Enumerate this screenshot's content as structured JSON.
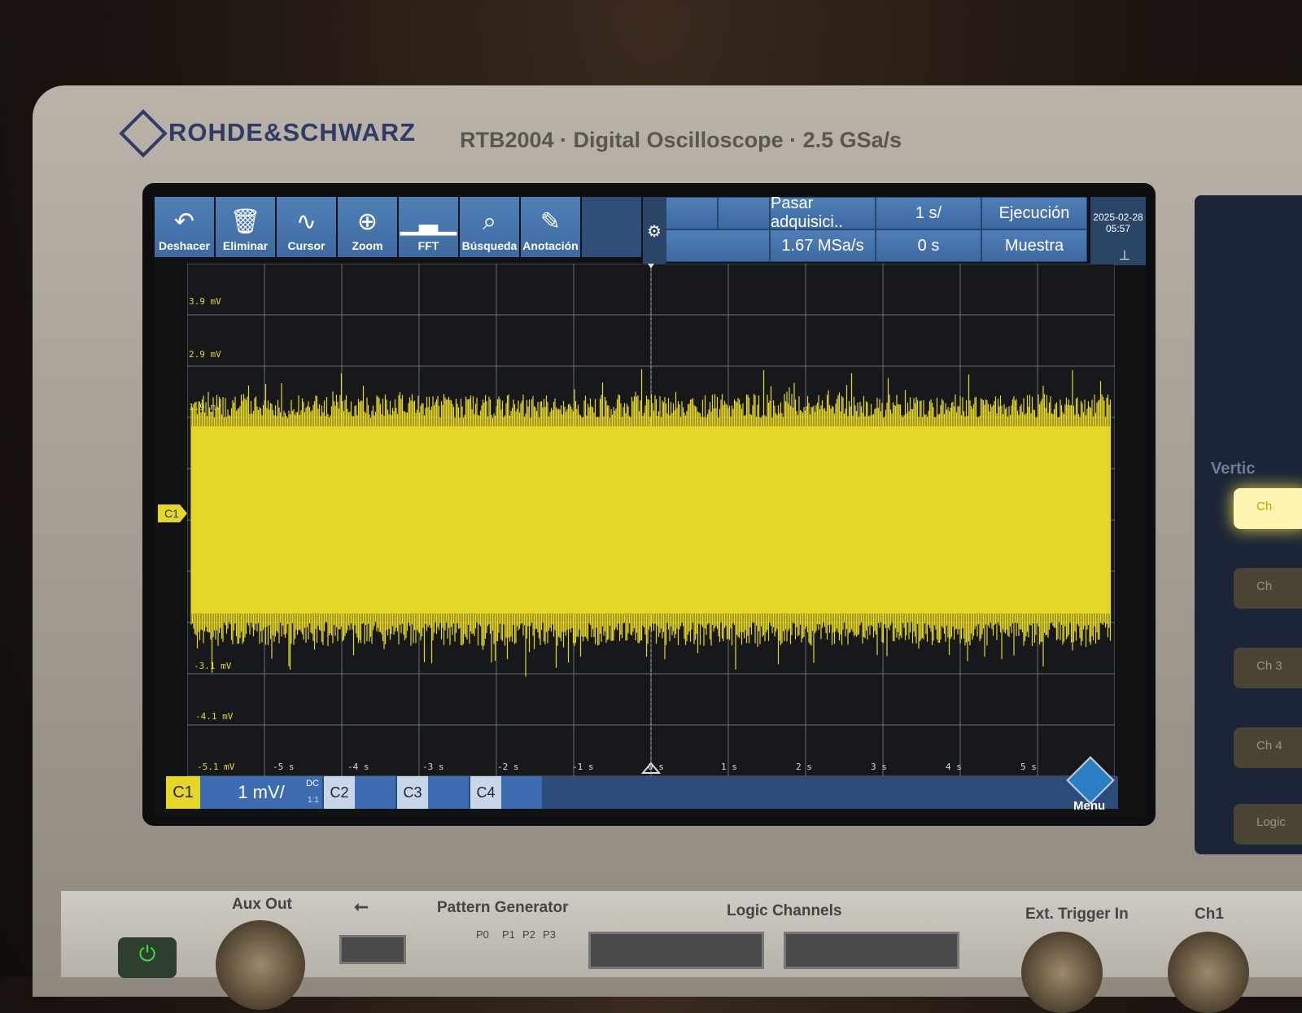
{
  "brand": {
    "name": "ROHDE&SCHWARZ",
    "model_line": "RTB2004 · Digital Oscilloscope · 2.5 GSa/s"
  },
  "toolbar": [
    {
      "label": "Deshacer",
      "icon": "undo-icon"
    },
    {
      "label": "Eliminar",
      "icon": "trash-icon"
    },
    {
      "label": "Cursor",
      "icon": "cursor-icon"
    },
    {
      "label": "Zoom",
      "icon": "zoom-icon"
    },
    {
      "label": "FFT",
      "icon": "fft-icon"
    },
    {
      "label": "Búsqueda",
      "icon": "search-icon"
    },
    {
      "label": "Anotación",
      "icon": "pencil-icon"
    }
  ],
  "status": {
    "acquisition": "Pasar adquisici..",
    "sample_rate": "1.67 MSa/s",
    "time_scale": "1 s/",
    "time_offset": "0 s",
    "run_state": "Ejecución",
    "mode": "Muestra",
    "date": "2025-02-28",
    "time": "05:57"
  },
  "plot": {
    "channel_marker": "C1",
    "y_labels": [
      "3.9 mV",
      "2.9 mV",
      "1.9 mV",
      "-3.1 mV",
      "-4.1 mV",
      "-5.1 mV"
    ],
    "x_labels": [
      "-5 s",
      "-4 s",
      "-3 s",
      "-2 s",
      "-1 s",
      "0 s",
      "1 s",
      "2 s",
      "3 s",
      "4 s",
      "5 s"
    ],
    "trace_color": "#e6d629"
  },
  "bottombar": {
    "c1": "C1",
    "c1_scale": "1 mV/",
    "coupling": "DC",
    "probe_ratio": "1:1",
    "c2": "C2",
    "c3": "C3",
    "c4": "C4",
    "menu": "Menu"
  },
  "side_panel": {
    "vertical_label": "Vertic",
    "buttons": [
      "Ch",
      "Ch",
      "Ch 3",
      "Ch 4",
      "Logic"
    ]
  },
  "front_panel": {
    "aux_out": "Aux Out",
    "pattern_generator": "Pattern Generator",
    "pattern_pins": [
      "P0",
      "P1",
      "P2",
      "P3"
    ],
    "logic_channels": "Logic Channels",
    "ext_trigger": "Ext. Trigger In",
    "ch1": "Ch1"
  }
}
